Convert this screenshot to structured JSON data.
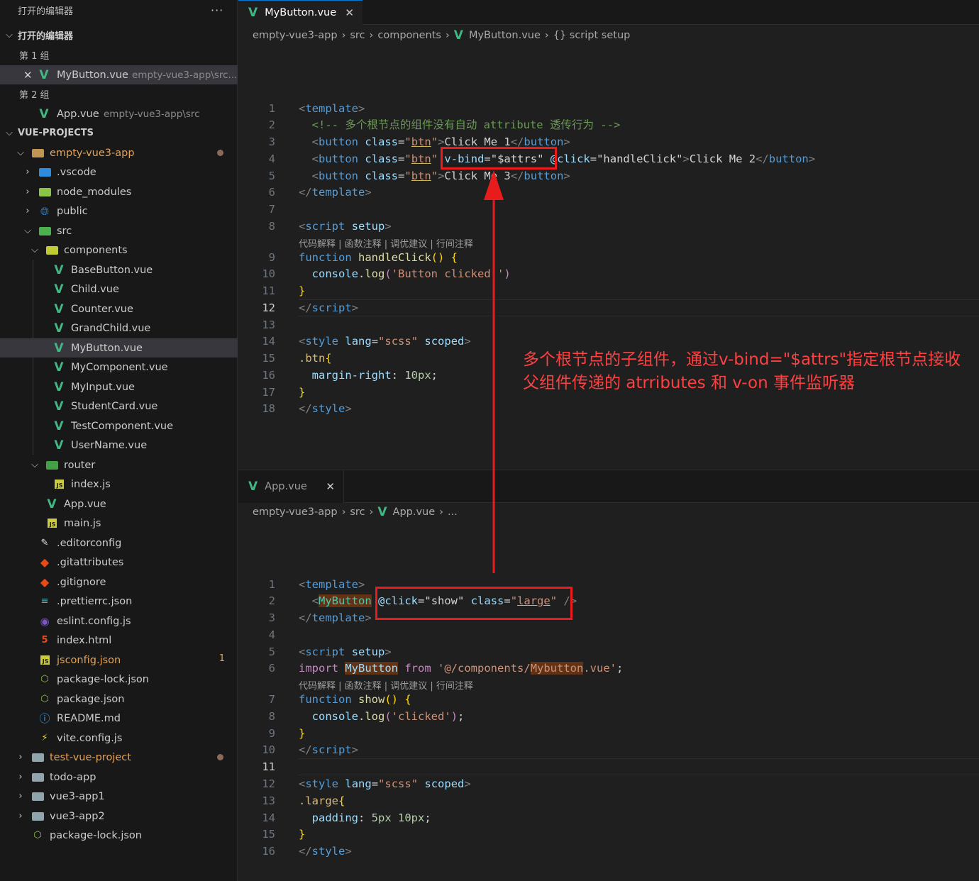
{
  "sidebar": {
    "title": "打开的编辑器",
    "more_icon": "ellipsis-icon",
    "open_editors_header": "打开的编辑器",
    "group1": "第 1 组",
    "group1_file": "MyButton.vue",
    "group1_path": "empty-vue3-app\\src...",
    "group2": "第 2 组",
    "group2_file": "App.vue",
    "group2_path": "empty-vue3-app\\src",
    "projects_header": "VUE-PROJECTS",
    "tree": [
      "empty-vue3-app",
      ".vscode",
      "node_modules",
      "public",
      "src",
      "components",
      "BaseButton.vue",
      "Child.vue",
      "Counter.vue",
      "GrandChild.vue",
      "MyButton.vue",
      "MyComponent.vue",
      "MyInput.vue",
      "StudentCard.vue",
      "TestComponent.vue",
      "UserName.vue",
      "router",
      "index.js",
      "App.vue",
      "main.js",
      ".editorconfig",
      ".gitattributes",
      ".gitignore",
      ".prettierrc.json",
      "eslint.config.js",
      "index.html",
      "jsconfig.json",
      "package-lock.json",
      "package.json",
      "README.md",
      "vite.config.js",
      "test-vue-project",
      "todo-app",
      "vue3-app1",
      "vue3-app2",
      "package-lock.json"
    ],
    "jsconfig_badge": "1"
  },
  "top_editor": {
    "tab": "MyButton.vue",
    "breadcrumb": [
      "empty-vue3-app",
      "src",
      "components",
      "MyButton.vue",
      "{} script setup"
    ],
    "lens": "代码解释 | 函数注释 | 调优建议 | 行间注释",
    "line_numbers": [
      "1",
      "2",
      "3",
      "4",
      "5",
      "6",
      "7",
      "8",
      "9",
      "10",
      "11",
      "12",
      "13",
      "14",
      "15",
      "16",
      "17",
      "18"
    ]
  },
  "bottom_editor": {
    "tab": "App.vue",
    "breadcrumb": [
      "empty-vue3-app",
      "src",
      "App.vue",
      "..."
    ],
    "lens": "代码解释 | 函数注释 | 调优建议 | 行间注释",
    "line_numbers": [
      "1",
      "2",
      "3",
      "4",
      "5",
      "6",
      "7",
      "8",
      "9",
      "10",
      "11",
      "12",
      "13",
      "14",
      "15",
      "16"
    ]
  },
  "annotation": {
    "line1": "多个根节点的子组件，通过v-bind=\"$attrs\"指定根节点接收",
    "line2": "父组件传递的 atrributes 和 v-on 事件监听器"
  },
  "colors": {
    "annotation": "#ff4040",
    "box": "#e81c1c",
    "vue_green": "#41b883"
  }
}
